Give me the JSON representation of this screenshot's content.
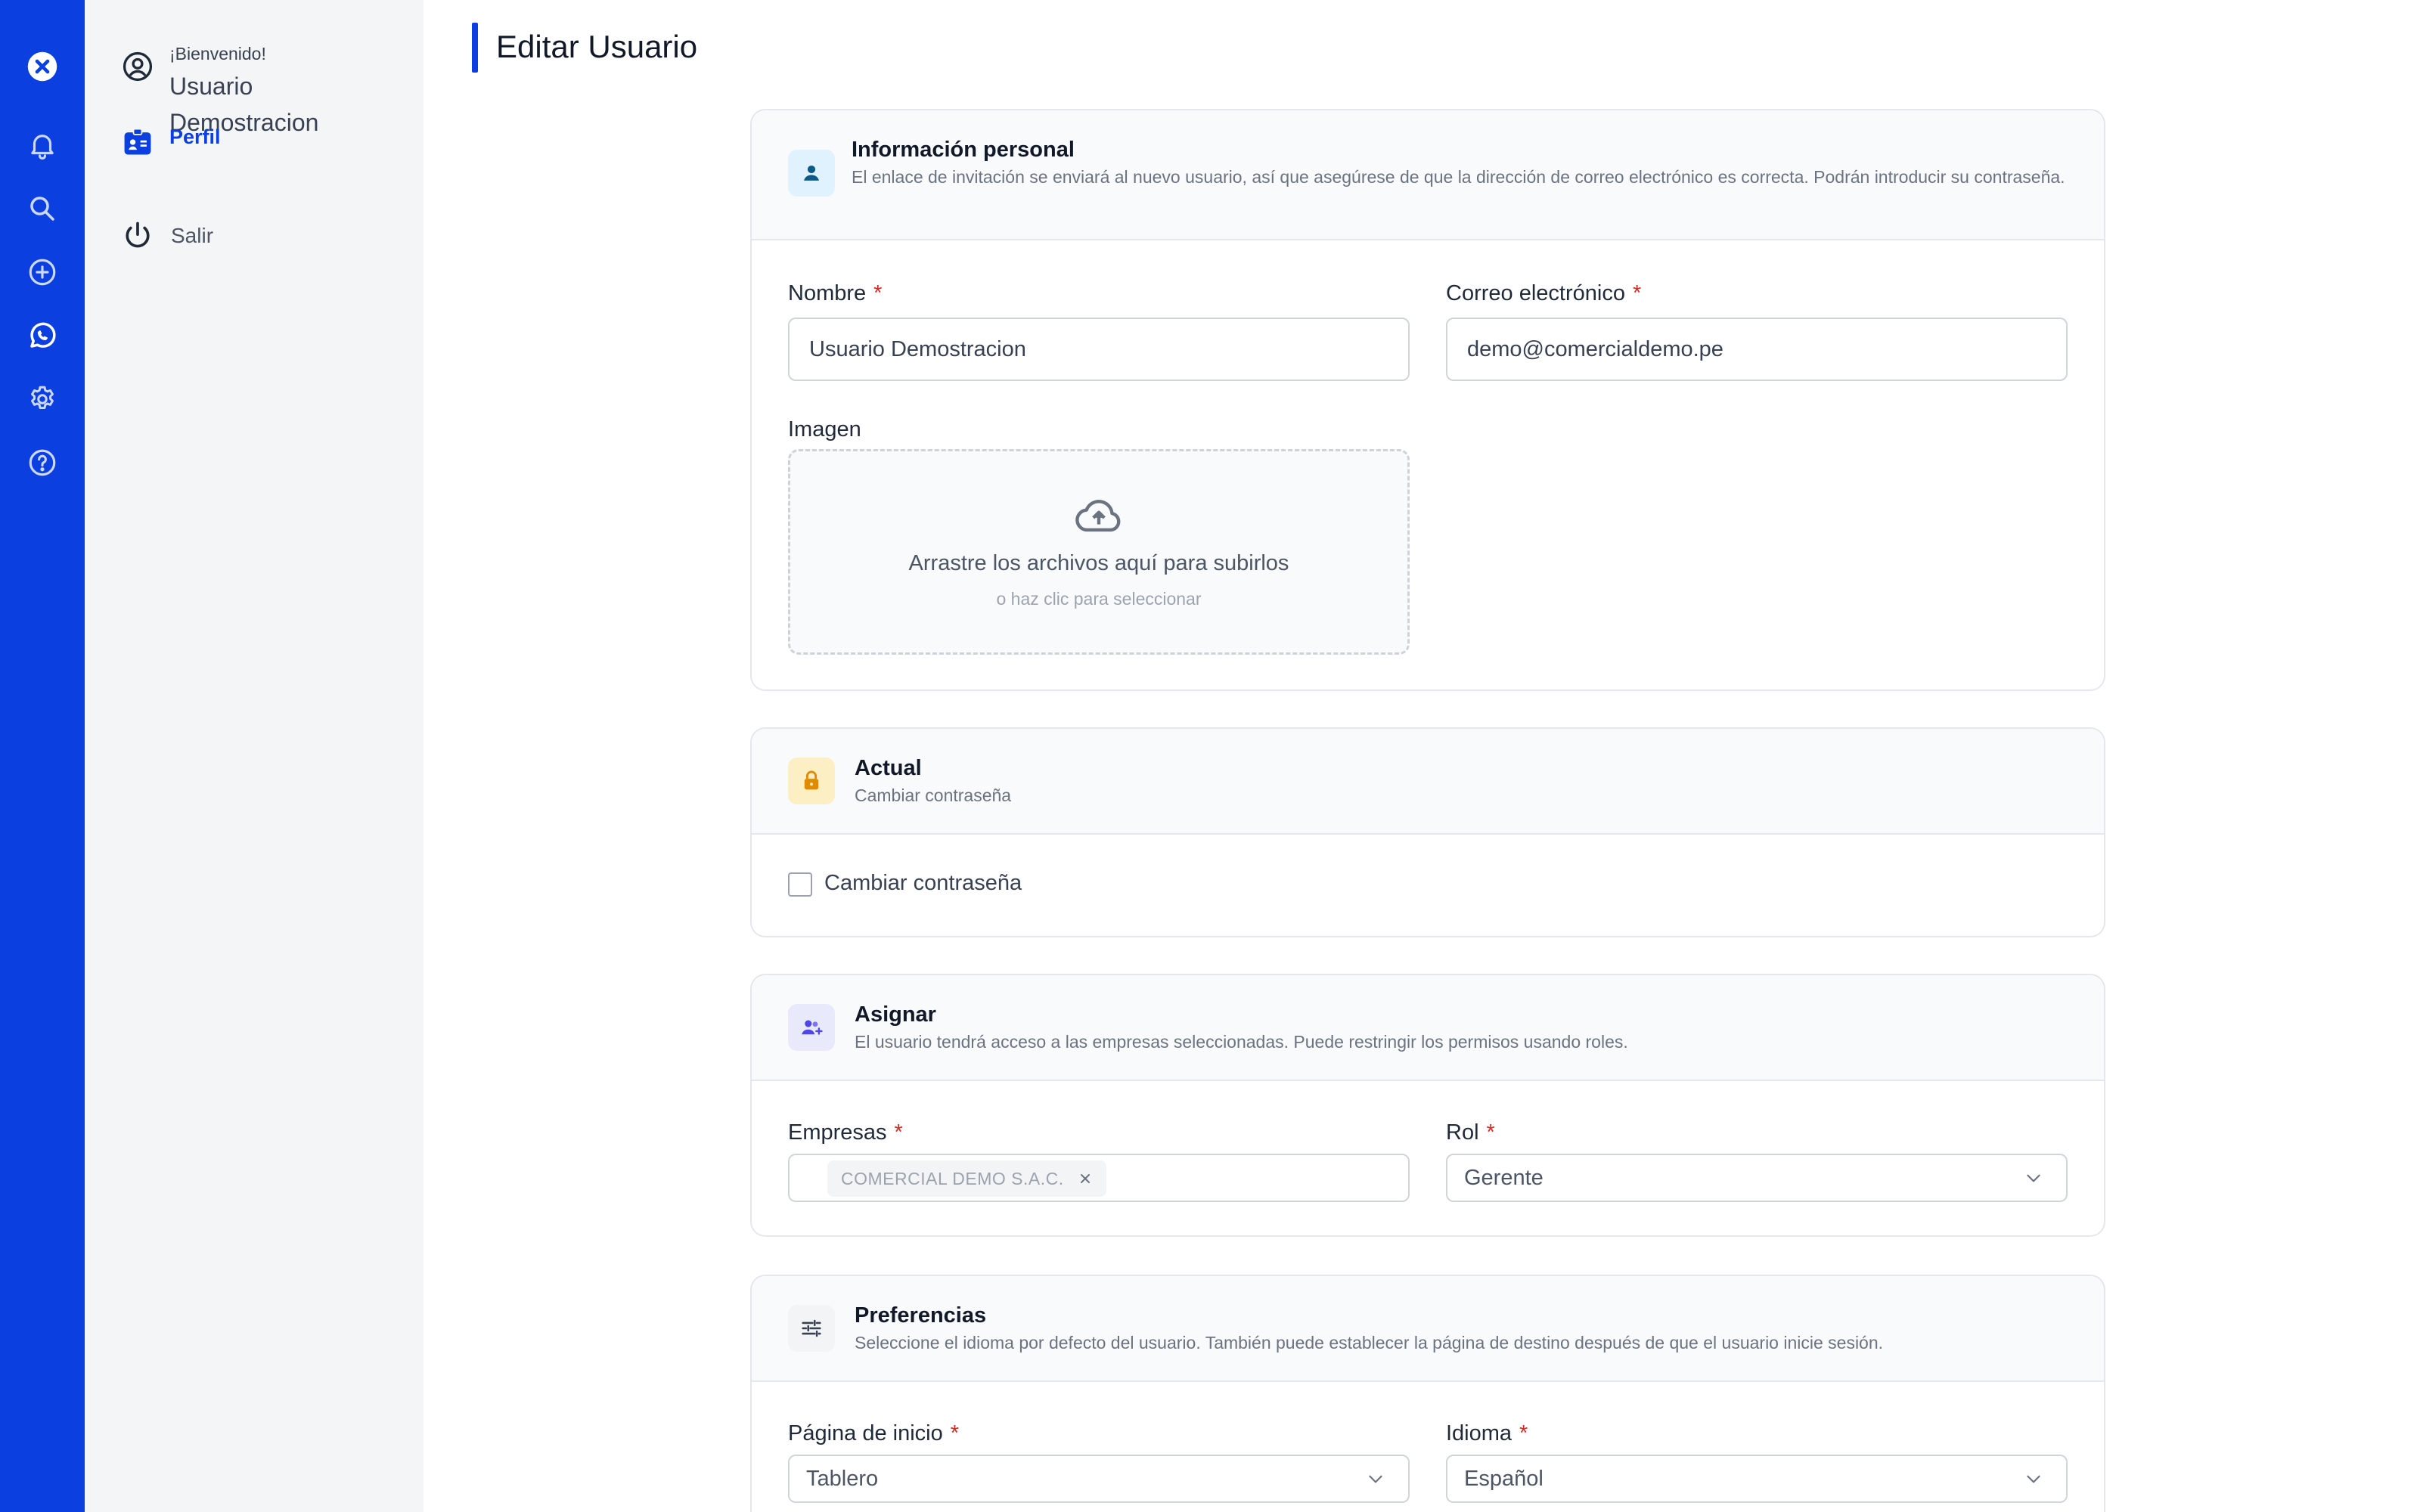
{
  "sidebar": {
    "welcome": "¡Bienvenido!",
    "user_name": "Usuario Demostracion",
    "profile_label": "Perfil",
    "logout_label": "Salir"
  },
  "page": {
    "title": "Editar Usuario"
  },
  "personal": {
    "title": "Información personal",
    "description": "El enlace de invitación se enviará al nuevo usuario, así que asegúrese de que la dirección de correo electrónico es correcta. Podrán introducir su contraseña.",
    "name_label": "Nombre",
    "name_value": "Usuario Demostracion",
    "email_label": "Correo electrónico",
    "email_value": "demo@comercialdemo.pe",
    "image_label": "Imagen",
    "dropzone_main": "Arrastre los archivos aquí para subirlos",
    "dropzone_sub": "o haz clic para seleccionar"
  },
  "password": {
    "title": "Actual",
    "description": "Cambiar contraseña",
    "checkbox_label": "Cambiar contraseña"
  },
  "assign": {
    "title": "Asignar",
    "description": "El usuario tendrá acceso a las empresas seleccionadas. Puede restringir los permisos usando roles.",
    "companies_label": "Empresas",
    "company_chip": "COMERCIAL DEMO S.A.C.",
    "role_label": "Rol",
    "role_value": "Gerente"
  },
  "preferences": {
    "title": "Preferencias",
    "description": "Seleccione el idioma por defecto del usuario. También puede establecer la página de destino después de que el usuario inicie sesión.",
    "home_label": "Página de inicio",
    "home_value": "Tablero",
    "language_label": "Idioma",
    "language_value": "Español"
  },
  "required_mark": "*",
  "colors": {
    "rail": "#0b3fe0",
    "accent": "#0b3fe0",
    "required": "#dc2626",
    "lock_bg": "#fdefc4",
    "lock": "#e08a00"
  }
}
